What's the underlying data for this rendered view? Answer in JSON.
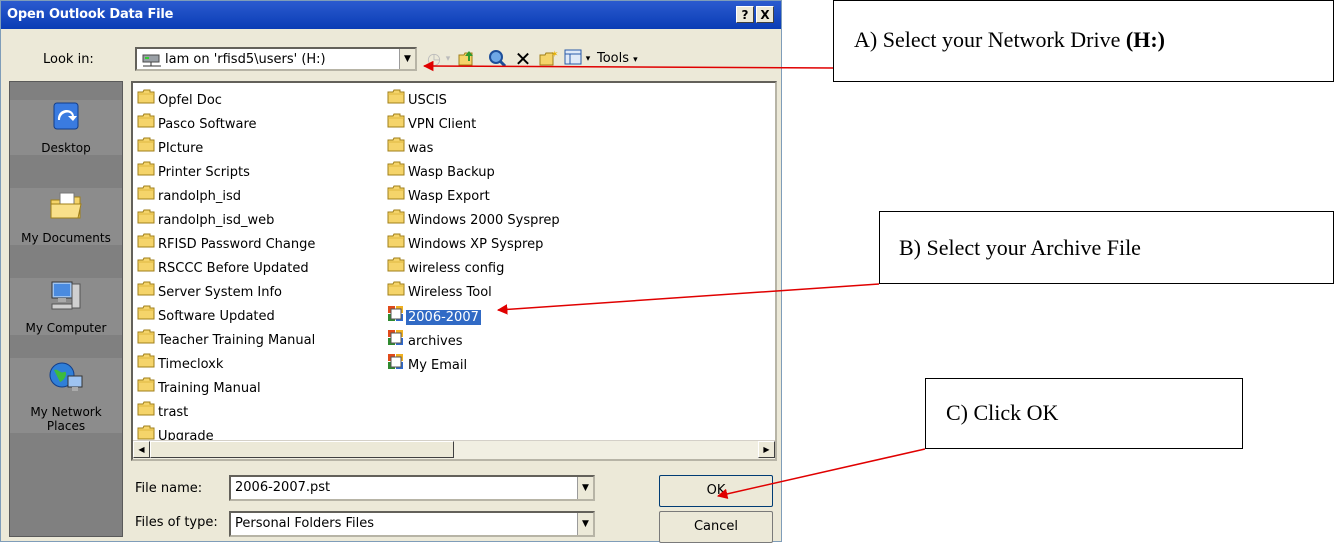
{
  "dialog": {
    "title": "Open Outlook Data File",
    "help_btn": "?",
    "close_btn": "X",
    "lookin_label": "Look in:",
    "lookin_value": "lam on 'rfisd5\\users' (H:)",
    "tools_label": "Tools"
  },
  "places": [
    {
      "label": "Desktop"
    },
    {
      "label": "My Documents"
    },
    {
      "label": "My Computer"
    },
    {
      "label": "My Network Places"
    }
  ],
  "files": {
    "col1": [
      "Opfel Doc",
      "Pasco Software",
      "PIcture",
      "Printer Scripts",
      "randolph_isd",
      "randolph_isd_web",
      "RFISD Password Change",
      "RSCCC Before Updated",
      "Server System Info",
      "Software Updated",
      "Teacher Training Manual",
      "Timecloxk",
      "Training Manual",
      "trast",
      "Upgrade"
    ],
    "col2_folders": [
      "USCIS",
      "VPN Client",
      "was",
      "Wasp Backup",
      "Wasp Export",
      "Windows 2000 Sysprep",
      "Windows  XP Sysprep",
      "wireless config",
      "Wireless Tool"
    ],
    "col2_pst": [
      "2006-2007",
      "archives",
      "My Email"
    ],
    "selected": "2006-2007"
  },
  "footer": {
    "filename_label": "File name:",
    "filename_value": "2006-2007.pst",
    "filetype_label": "Files of type:",
    "filetype_value": "Personal Folders Files",
    "ok_label": "OK",
    "cancel_label": "Cancel"
  },
  "callouts": {
    "a_text": "A) Select your Network Drive ",
    "a_bold": "(H:)",
    "b_text": "B) Select your Archive File",
    "c_text": "C) Click OK"
  },
  "colors": {
    "title_bar": "#0a3cb5",
    "selection": "#316ac5",
    "arrow": "#e00000",
    "folder": "#f5d46a"
  }
}
